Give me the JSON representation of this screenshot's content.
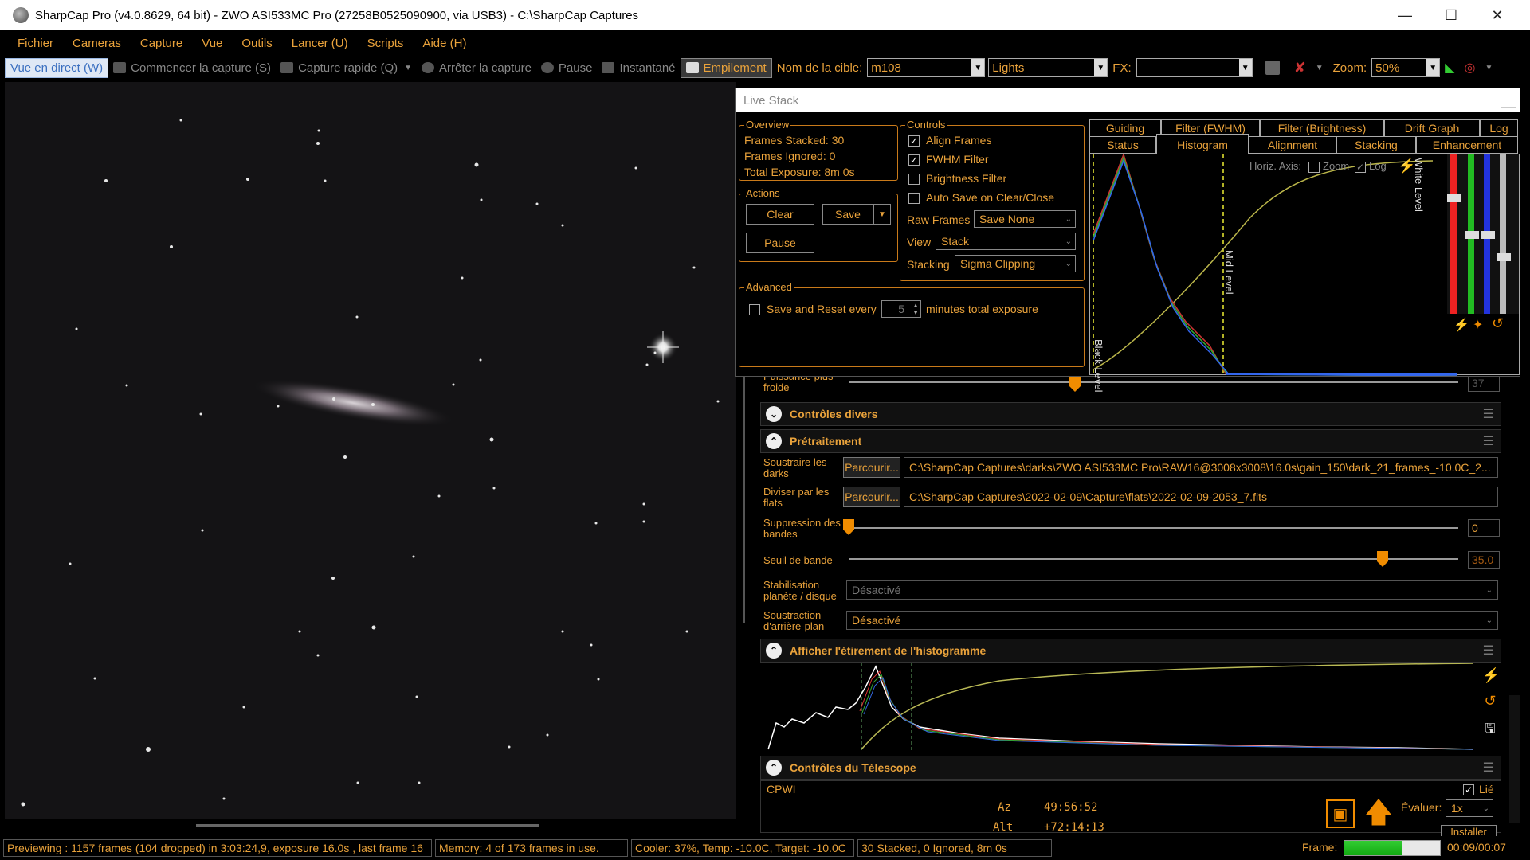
{
  "window": {
    "title": "SharpCap Pro (v4.0.8629, 64 bit) - ZWO ASI533MC Pro (27258B0525090900, via USB3) - C:\\SharpCap Captures"
  },
  "menu": [
    "Fichier",
    "Cameras",
    "Capture",
    "Vue",
    "Outils",
    "Lancer (U)",
    "Scripts",
    "Aide (H)"
  ],
  "toolbar": {
    "live_view": "Vue en direct (W)",
    "start_capture": "Commencer la capture (S)",
    "quick_capture": "Capture rapide (Q)",
    "stop_capture": "Arrêter la capture",
    "pause": "Pause",
    "snapshot": "Instantané",
    "stacking": "Empilement",
    "target_label": "Nom de la cible:",
    "target_value": "m108",
    "frame_type": "Lights",
    "fx_label": "FX:",
    "fx_value": "",
    "zoom_label": "Zoom:",
    "zoom_value": "50%"
  },
  "live_stack": {
    "title": "Live Stack",
    "overview_label": "Overview",
    "frames_stacked": "Frames Stacked: 30",
    "frames_ignored": "Frames Ignored:  0",
    "total_exposure": "Total Exposure:   8m 0s",
    "actions_label": "Actions",
    "clear_btn": "Clear",
    "save_btn": "Save",
    "pause_btn": "Pause",
    "controls_label": "Controls",
    "align_frames": "Align Frames",
    "fwhm_filter": "FWHM Filter",
    "brightness_filter": "Brightness Filter",
    "auto_save": "Auto Save on Clear/Close",
    "raw_frames_label": "Raw Frames",
    "raw_frames_value": "Save None",
    "view_label": "View",
    "view_value": "Stack",
    "stacking_label": "Stacking",
    "stacking_value": "Sigma Clipping",
    "advanced_label": "Advanced",
    "save_reset_label": "Save and Reset every",
    "save_reset_value": "5",
    "save_reset_suffix": "minutes total exposure",
    "tabs_row1": [
      "Guiding",
      "Filter (FWHM)",
      "Filter (Brightness)",
      "Drift Graph",
      "Log"
    ],
    "tabs_row2": [
      "Status",
      "Histogram",
      "Alignment",
      "Stacking",
      "Enhancement"
    ],
    "active_tab": "Histogram",
    "horiz_axis": "Horiz. Axis:",
    "zoom_chk": "Zoom",
    "log_chk": "Log",
    "black_level": "Black Level",
    "mid_level": "Mid Level",
    "white_level": "White Level"
  },
  "panel": {
    "partial_label": "Puissance plus froide",
    "partial_value": "37",
    "misc_section": "Contrôles divers",
    "preprocessing_section": "Prétraitement",
    "subtract_darks_label": "Soustraire les darks",
    "browse": "Parcourir...",
    "darks_path": "C:\\SharpCap Captures\\darks\\ZWO ASI533MC Pro\\RAW16@3008x3008\\16.0s\\gain_150\\dark_21_frames_-10.0C_2...",
    "divide_flats_label": "Diviser par les flats",
    "flats_path": "C:\\SharpCap Captures\\2022-02-09\\Capture\\flats\\2022-02-09-2053_7.fits",
    "banding_label": "Suppression des bandes",
    "banding_value": "0",
    "banding_threshold_label": "Seuil de bande",
    "banding_threshold_value": "35.0",
    "stabilisation_label": "Stabilisation planète / disque",
    "stabilisation_value": "Désactivé",
    "bg_subtraction_label": "Soustraction d'arrière-plan",
    "bg_subtraction_value": "Désactivé",
    "histogram_section": "Afficher l'étirement de l'histogramme",
    "telescope_section": "Contrôles du Télescope",
    "telescope_name": "CPWI",
    "az_label": "Az",
    "az_value": "49:56:52",
    "alt_label": "Alt",
    "alt_value": "+72:14:13",
    "linked": "Lié",
    "rate_label": "Évaluer:",
    "rate_value": "1x",
    "install_btn": "Installer",
    "frame_label": "Frame:",
    "frame_value": "00:09/00:07"
  },
  "status": {
    "preview": "Previewing : 1157 frames (104 dropped) in 3:03:24,9, exposure 16.0s , last frame 16",
    "memory": "Memory: 4 of 173 frames in use.",
    "cooler": "Cooler: 37%, Temp: -10.0C, Target: -10.0C",
    "stacked": "30 Stacked, 0 Ignored, 8m 0s"
  },
  "colors": {
    "accent": "#e9a23b",
    "slider": "#f08c00"
  }
}
